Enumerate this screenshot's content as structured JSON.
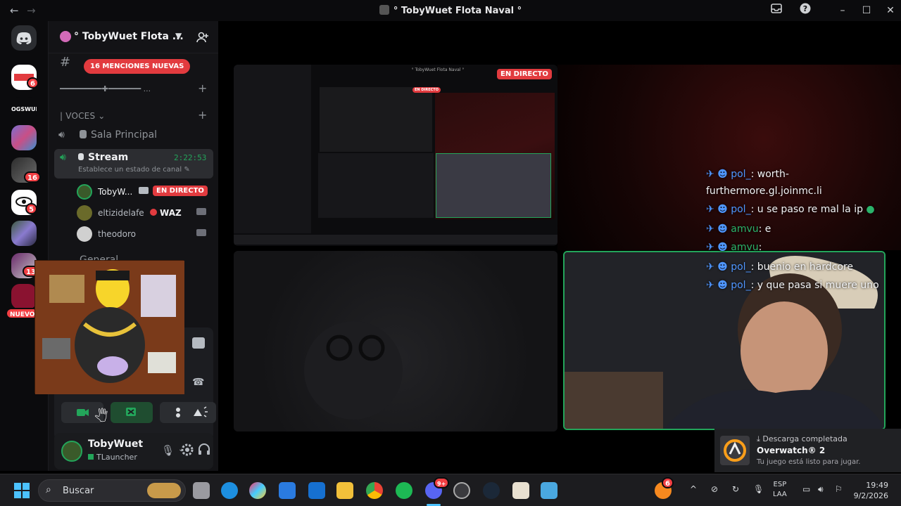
{
  "window": {
    "title": "° TobyWuet Flota Naval °",
    "back_glyph": "←",
    "forward_glyph": "→"
  },
  "rail": {
    "badges": [
      "6",
      "16",
      "5",
      "13",
      "NUEVO"
    ]
  },
  "sidebar": {
    "guild_name": "° TobyWuet Flota ...",
    "mentions_pill": "16 MENCIONES NUEVAS",
    "divider_channel": "━━━━━━━━━✚━━━━━━━ ...",
    "voice_section": "| VOCES",
    "channels": [
      {
        "name": "Sala Principal"
      },
      {
        "name": "Stream",
        "timer": "2:22:53",
        "status": "Establece un estado de canal"
      }
    ],
    "participants": [
      {
        "name": "TobyW...",
        "badge": "EN DIRECTO"
      },
      {
        "name": "eltizidelafe",
        "tag": "WAZ"
      },
      {
        "name": "theodoro"
      }
    ],
    "next_channel": "General",
    "user": {
      "name": "TobyWuet",
      "activity": "TLauncher"
    }
  },
  "stage": {
    "live_badge": "EN DIRECTO",
    "mini_live": "EN DIRECTO",
    "mini_title": "° TobyWuet Flota Naval °",
    "chat": [
      {
        "user": "pol_",
        "text": ": worth-"
      },
      {
        "user": "",
        "text": "furthermore.gl.joinmc.li"
      },
      {
        "user": "pol_",
        "text": ": u se paso re mal la ip"
      },
      {
        "user": "amvu",
        "text": ": e"
      },
      {
        "user": "amvu",
        "text": ":"
      },
      {
        "user": "pol_",
        "text": ": buenio en hardcore"
      },
      {
        "user": "pol_",
        "text": ": y que pasa si muere uno"
      }
    ]
  },
  "toast": {
    "header": "Descarga completada",
    "title": "Overwatch® 2",
    "body": "Tu juego está listo para jugar."
  },
  "taskbar": {
    "search_placeholder": "Buscar",
    "lang": "ESP",
    "lang2": "LAA",
    "time": "19:49",
    "date": "9/2/2026",
    "copilot_badge": "6",
    "discord_badge": "9+"
  },
  "colors": {
    "accent_red": "#e23b3f",
    "discord_blurple": "#5865f2",
    "speaking_green": "#23a55a"
  }
}
